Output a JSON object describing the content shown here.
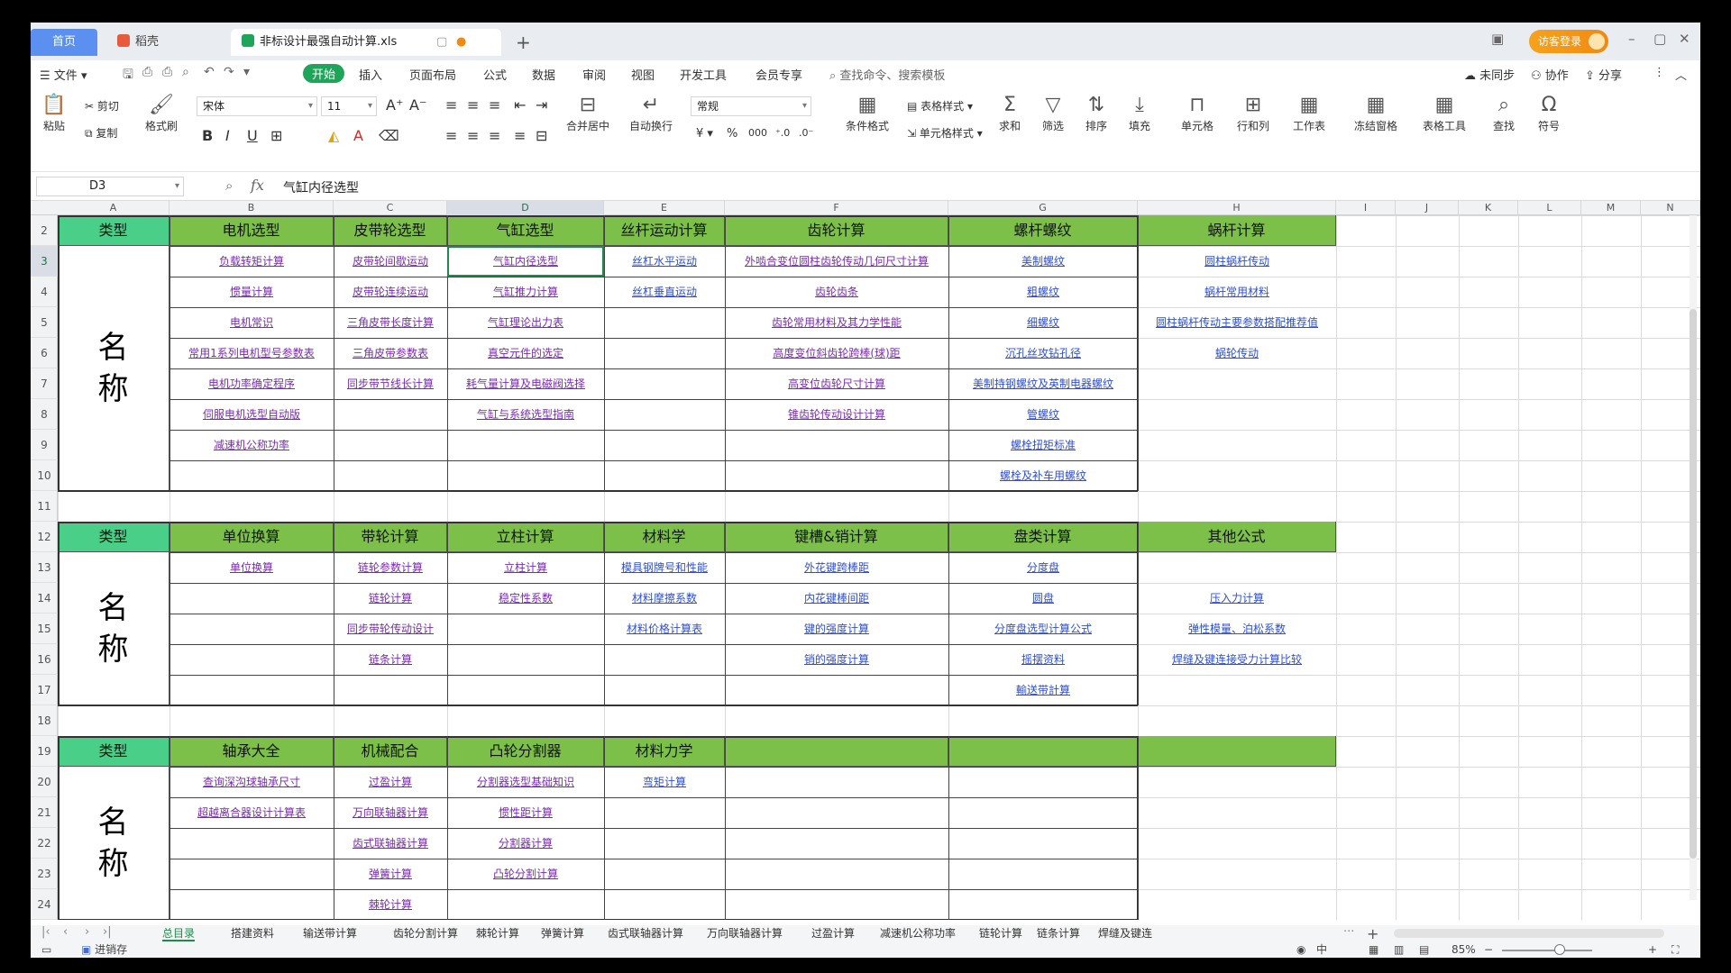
{
  "tabs": {
    "home": "首页",
    "docer": "稻壳",
    "file": "非标设计最强自动计算.xls"
  },
  "visitor_label": "访客登录",
  "menu": [
    "文件",
    "开始",
    "插入",
    "页面布局",
    "公式",
    "数据",
    "审阅",
    "视图",
    "开发工具",
    "会员专享"
  ],
  "menu_search": "查找命令、搜索模板",
  "menu_right": [
    "未同步",
    "协作",
    "分享"
  ],
  "ribbon": {
    "paste": "粘贴",
    "cut": "剪切",
    "copy": "复制",
    "format_painter": "格式刷",
    "font_name": "宋体",
    "font_size": "11",
    "merge": "合并居中",
    "wrap": "自动换行",
    "number_format": "常规",
    "cond_format": "条件格式",
    "table_style": "表格样式",
    "cell_style": "单元格样式",
    "sum": "求和",
    "filter": "筛选",
    "sort": "排序",
    "fill": "填充",
    "cell": "单元格",
    "row_col": "行和列",
    "worksheet": "工作表",
    "freeze": "冻结窗格",
    "table_tools": "表格工具",
    "find": "查找",
    "symbol": "符号"
  },
  "formula_bar": {
    "cell_ref": "D3",
    "content": "气缸内径选型"
  },
  "columns": [
    "A",
    "B",
    "C",
    "D",
    "E",
    "F",
    "G",
    "H",
    "I",
    "J",
    "K",
    "L",
    "M",
    "N"
  ],
  "rows": [
    "2",
    "3",
    "4",
    "5",
    "6",
    "7",
    "8",
    "9",
    "10",
    "11",
    "12",
    "13",
    "14",
    "15",
    "16",
    "17",
    "18",
    "19",
    "20",
    "21",
    "22",
    "23",
    "24"
  ],
  "type_label": "类型",
  "name_label": [
    "名",
    "称"
  ],
  "section1": {
    "headers": [
      "电机选型",
      "皮带轮选型",
      "气缸选型",
      "丝杆运动计算",
      "齿轮计算",
      "螺杆螺纹",
      "蜗杆计算"
    ],
    "cells": [
      [
        "负载转矩计算",
        "皮带轮间歇运动",
        "气缸内径选型",
        "丝杠水平运动",
        "外啮合变位圆柱齿轮传动几何尺寸计算",
        "美制螺纹",
        "圆柱蜗杆传动"
      ],
      [
        "惯量计算",
        "皮带轮连续运动",
        "气缸推力计算",
        "丝杠垂直运动",
        "齿轮齿条",
        "粗螺纹",
        "蜗杆常用材料"
      ],
      [
        "电机常识",
        "三角皮带长度计算",
        "气缸理论出力表",
        "",
        "齿轮常用材料及其力学性能",
        "细螺纹",
        "圆柱蜗杆传动主要参数搭配推荐值"
      ],
      [
        "常用1系列电机型号参数表",
        "三角皮带参数表",
        "真空元件的选定",
        "",
        "高度变位斜齿轮跨棒(球)距",
        "沉孔丝攻钻孔径",
        "蜗轮传动"
      ],
      [
        "电机功率确定程序",
        "同步带节线长计算",
        "耗气量计算及电磁阀选择",
        "",
        "高变位齿轮尺寸计算",
        "美制持钢螺纹及英制电器螺纹",
        ""
      ],
      [
        "伺服电机选型自动版",
        "",
        "气缸与系统选型指南",
        "",
        "锥齿轮传动设计计算",
        "管螺纹",
        ""
      ],
      [
        "减速机公称功率",
        "",
        "",
        "",
        "",
        "螺栓扭矩标准",
        ""
      ],
      [
        "",
        "",
        "",
        "",
        "",
        "螺栓及补车用螺纹",
        ""
      ]
    ]
  },
  "section2": {
    "headers": [
      "单位换算",
      "带轮计算",
      "立柱计算",
      "材料学",
      "键槽&销计算",
      "盘类计算",
      "其他公式"
    ],
    "cells": [
      [
        "单位换算",
        "链轮参数计算",
        "立柱计算",
        "模具钢牌号和性能",
        "外花键跨棒距",
        "分度盘",
        ""
      ],
      [
        "",
        "链轮计算",
        "稳定性系数",
        "材料摩擦系数",
        "内花键棒间距",
        "圆盘",
        "压入力计算"
      ],
      [
        "",
        "同步带轮传动设计",
        "",
        "材料价格计算表",
        "键的强度计算",
        "分度盘选型计算公式",
        "弹性模量、泊松系数"
      ],
      [
        "",
        "链条计算",
        "",
        "",
        "销的强度计算",
        "摇摆资料",
        "焊缝及键连接受力计算比较"
      ],
      [
        "",
        "",
        "",
        "",
        "",
        "輸送带計算",
        ""
      ]
    ]
  },
  "section3": {
    "headers": [
      "轴承大全",
      "机械配合",
      "凸轮分割器",
      "材料力学",
      "",
      "",
      ""
    ],
    "cells": [
      [
        "查询深沟球轴承尺寸",
        "过盈计算",
        "分割器选型基础知识",
        "弯矩计算",
        "",
        "",
        ""
      ],
      [
        "超越离合器设计计算表",
        "万向联轴器计算",
        "惯性距计算",
        "",
        "",
        "",
        ""
      ],
      [
        "",
        "齿式联轴器计算",
        "分割器计算",
        "",
        "",
        "",
        ""
      ],
      [
        "",
        "弹簧计算",
        "凸轮分割计算",
        "",
        "",
        "",
        ""
      ],
      [
        "",
        "棘轮计算",
        "",
        "",
        "",
        "",
        ""
      ]
    ]
  },
  "sheet_tabs": [
    "总目录",
    "搭建资料",
    "输送带计算",
    "齿轮分割计算",
    "棘轮计算",
    "弹簧计算",
    "齿式联轴器计算",
    "万向联轴器计算",
    "过盈计算",
    "减速机公称功率",
    "链轮计算",
    "链条计算",
    "焊缝及键连"
  ],
  "status": {
    "left": "进销存",
    "input_mode": "中",
    "zoom": "85%"
  },
  "colors": {
    "header_green": "#7cc04a",
    "type_green": "#49cf87",
    "link_purple": "#7a2bb0",
    "link_blue": "#2f4fd0",
    "brand_green": "#1ea55a"
  }
}
